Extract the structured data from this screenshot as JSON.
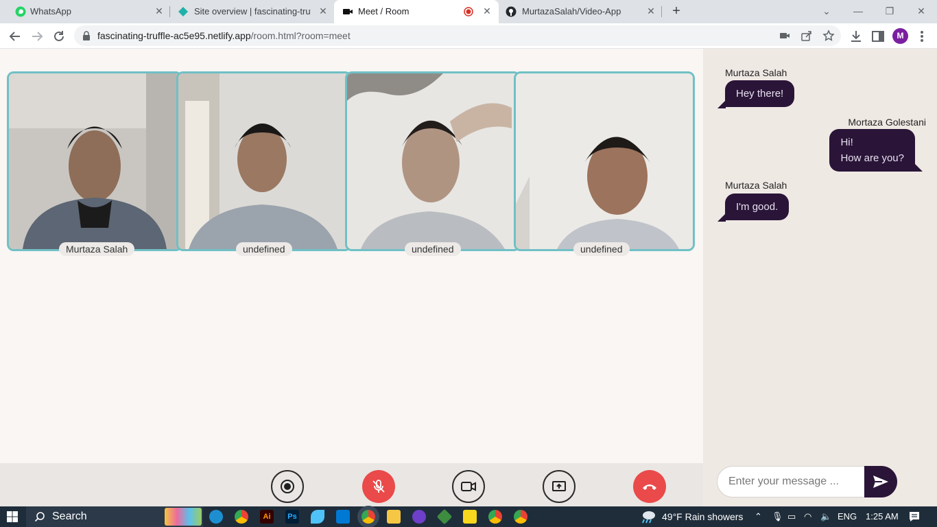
{
  "browser": {
    "tabs": [
      {
        "title": "WhatsApp",
        "active": false
      },
      {
        "title": "Site overview | fascinating-truffle",
        "active": false
      },
      {
        "title": "Meet / Room",
        "active": true
      },
      {
        "title": "MurtazaSalah/Video-App",
        "active": false
      }
    ],
    "url_host": "fascinating-truffle-ac5e95.netlify.app",
    "url_path": "/room.html?room=meet",
    "profile_initial": "M"
  },
  "room": {
    "participants": [
      {
        "name": "Murtaza Salah"
      },
      {
        "name": "undefined"
      },
      {
        "name": "undefined"
      },
      {
        "name": "undefined"
      }
    ],
    "controls": {
      "record": "record-icon",
      "mic": "mic-off-icon",
      "camera": "video-camera-icon",
      "share": "screen-share-icon",
      "hangup": "phone-hangup-icon"
    }
  },
  "chat": {
    "messages": [
      {
        "author": "Murtaza Salah",
        "lines": [
          "Hey there!"
        ],
        "side": "left"
      },
      {
        "author": "Mortaza Golestani",
        "lines": [
          "Hi!",
          "How are you?"
        ],
        "side": "right"
      },
      {
        "author": "Murtaza Salah",
        "lines": [
          "I'm good."
        ],
        "side": "left"
      }
    ],
    "input_placeholder": "Enter your message ..."
  },
  "taskbar": {
    "search_label": "Search",
    "weather": "49°F  Rain showers",
    "language": "ENG",
    "time": "1:25 AM"
  },
  "colors": {
    "tile_border": "#6fc0c6",
    "bubble": "#2a1538",
    "hangup_red": "#ea4a4a"
  }
}
